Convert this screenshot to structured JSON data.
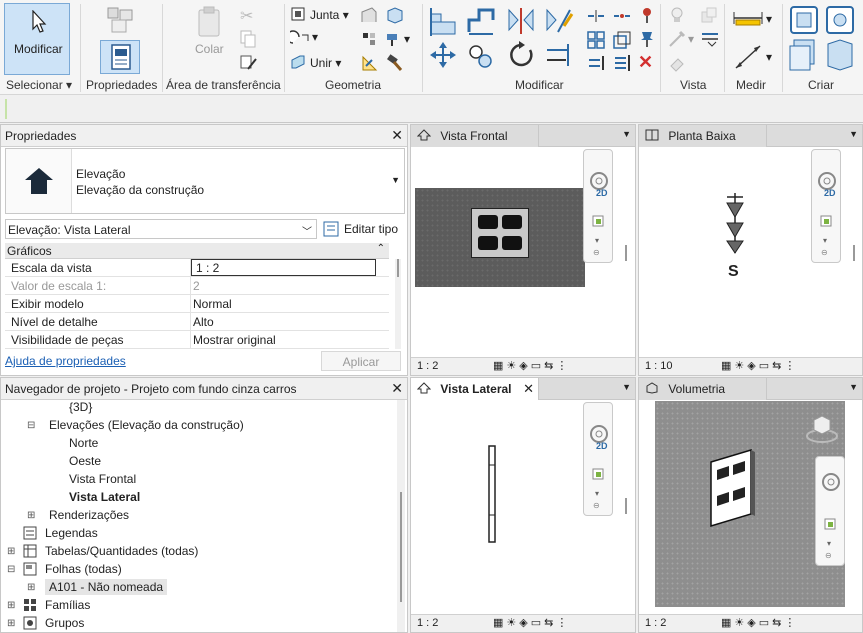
{
  "ribbon": {
    "groups": {
      "selecionar": "Selecionar",
      "propriedades": "Propriedades",
      "area": "Área de transferência",
      "geometria": "Geometria",
      "modificar": "Modificar",
      "vista": "Vista",
      "medir": "Medir",
      "criar": "Criar"
    },
    "modificar_button": "Modificar",
    "colar": "Colar",
    "junta": "Junta",
    "unir": "Unir"
  },
  "properties": {
    "title": "Propriedades",
    "type_name": "Elevação",
    "type_sub": "Elevação da construção",
    "selector": "Elevação: Vista Lateral",
    "edit_type": "Editar tipo",
    "section": "Gráficos",
    "rows": [
      {
        "k": "Escala da vista",
        "v": "1 : 2"
      },
      {
        "k": "Valor de escala    1:",
        "v": "2"
      },
      {
        "k": "Exibir modelo",
        "v": "Normal"
      },
      {
        "k": "Nível de detalhe",
        "v": "Alto"
      },
      {
        "k": "Visibilidade de peças",
        "v": "Mostrar original"
      }
    ],
    "help": "Ajuda de propriedades",
    "apply": "Aplicar"
  },
  "browser": {
    "title": "Navegador de projeto - Projeto com fundo cinza carros",
    "items": [
      {
        "label": "{3D}"
      },
      {
        "label": "Elevações (Elevação da construção)"
      },
      {
        "label": "Norte"
      },
      {
        "label": "Oeste"
      },
      {
        "label": "Vista Frontal"
      },
      {
        "label": "Vista Lateral"
      },
      {
        "label": "Renderizações"
      },
      {
        "label": "Legendas"
      },
      {
        "label": "Tabelas/Quantidades (todas)"
      },
      {
        "label": "Folhas (todas)"
      },
      {
        "label": "A101 - Não nomeada"
      },
      {
        "label": "Famílias"
      },
      {
        "label": "Grupos"
      }
    ]
  },
  "views": {
    "frontal": {
      "title": "Vista Frontal",
      "scale": "1 : 2"
    },
    "planta": {
      "title": "Planta Baixa",
      "scale": "1 : 10",
      "marker": "S"
    },
    "lateral": {
      "title": "Vista Lateral",
      "scale": "1 : 2"
    },
    "volumetria": {
      "title": "Volumetria",
      "scale": "1 : 2"
    },
    "nav_2d": "2D"
  }
}
